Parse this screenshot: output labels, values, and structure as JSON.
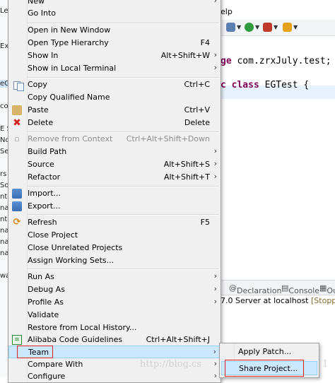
{
  "background": {
    "menubar_fragment": "elp",
    "left_fragments": [
      "Lef",
      "Ex",
      "eG",
      "co",
      "E S",
      "No",
      "Ser",
      "rs",
      "Sor",
      "nt-",
      "na",
      "nt-",
      "na",
      "na",
      "na",
      "wa"
    ],
    "code": {
      "line1_kw": "ge",
      "line1_rest": " com.zrxJuly.test;",
      "line2_kw": "c class",
      "line2_rest": " EGTest {"
    },
    "views": {
      "declaration": "Declaration",
      "console": "Console",
      "more": "Ou"
    },
    "server": {
      "name": "7.0 Server at localhost",
      "status": "[Stopped]"
    },
    "watermark": "http://blog.cs",
    "watermark_tail": "1"
  },
  "context_menu": {
    "items": [
      {
        "label": "New",
        "shortcut": "",
        "submenu": true,
        "icon": ""
      },
      {
        "label": "Go Into",
        "shortcut": "",
        "submenu": false,
        "icon": ""
      },
      {
        "label": "Open in New Window",
        "shortcut": "",
        "submenu": false,
        "icon": ""
      },
      {
        "label": "Open Type Hierarchy",
        "shortcut": "F4",
        "submenu": false,
        "icon": ""
      },
      {
        "label": "Show In",
        "shortcut": "Alt+Shift+W",
        "submenu": true,
        "icon": ""
      },
      {
        "label": "Show in Local Terminal",
        "shortcut": "",
        "submenu": true,
        "icon": ""
      },
      {
        "label": "Copy",
        "shortcut": "Ctrl+C",
        "submenu": false,
        "icon": "copy-icon"
      },
      {
        "label": "Copy Qualified Name",
        "shortcut": "",
        "submenu": false,
        "icon": ""
      },
      {
        "label": "Paste",
        "shortcut": "Ctrl+V",
        "submenu": false,
        "icon": "paste-icon"
      },
      {
        "label": "Delete",
        "shortcut": "Delete",
        "submenu": false,
        "icon": "delete-icon"
      },
      {
        "label": "Remove from Context",
        "shortcut": "Ctrl+Alt+Shift+Down",
        "submenu": false,
        "icon": "",
        "disabled": true
      },
      {
        "label": "Build Path",
        "shortcut": "",
        "submenu": true,
        "icon": ""
      },
      {
        "label": "Source",
        "shortcut": "Alt+Shift+S",
        "submenu": true,
        "icon": ""
      },
      {
        "label": "Refactor",
        "shortcut": "Alt+Shift+T",
        "submenu": true,
        "icon": ""
      },
      {
        "label": "Import...",
        "shortcut": "",
        "submenu": false,
        "icon": "import-icon"
      },
      {
        "label": "Export...",
        "shortcut": "",
        "submenu": false,
        "icon": "export-icon"
      },
      {
        "label": "Refresh",
        "shortcut": "F5",
        "submenu": false,
        "icon": "refresh-icon"
      },
      {
        "label": "Close Project",
        "shortcut": "",
        "submenu": false,
        "icon": ""
      },
      {
        "label": "Close Unrelated Projects",
        "shortcut": "",
        "submenu": false,
        "icon": ""
      },
      {
        "label": "Assign Working Sets...",
        "shortcut": "",
        "submenu": false,
        "icon": ""
      },
      {
        "label": "Run As",
        "shortcut": "",
        "submenu": true,
        "icon": ""
      },
      {
        "label": "Debug As",
        "shortcut": "",
        "submenu": true,
        "icon": ""
      },
      {
        "label": "Profile As",
        "shortcut": "",
        "submenu": true,
        "icon": ""
      },
      {
        "label": "Validate",
        "shortcut": "",
        "submenu": false,
        "icon": ""
      },
      {
        "label": "Restore from Local History...",
        "shortcut": "",
        "submenu": false,
        "icon": ""
      },
      {
        "label": "Alibaba Code Guidelines",
        "shortcut": "Ctrl+Alt+Shift+J",
        "submenu": false,
        "icon": "alibaba-icon"
      },
      {
        "label": "Team",
        "shortcut": "",
        "submenu": true,
        "icon": "",
        "highlighted": true
      },
      {
        "label": "Compare With",
        "shortcut": "",
        "submenu": true,
        "icon": ""
      },
      {
        "label": "Configure",
        "shortcut": "",
        "submenu": true,
        "icon": ""
      }
    ]
  },
  "team_submenu": {
    "items": [
      {
        "label": "Apply Patch..."
      },
      {
        "label": "Share Project...",
        "highlighted": true
      }
    ]
  },
  "colors": {
    "highlight": "#cce8ff",
    "annotation_box": "#e02020",
    "keyword": "#7f0055"
  }
}
